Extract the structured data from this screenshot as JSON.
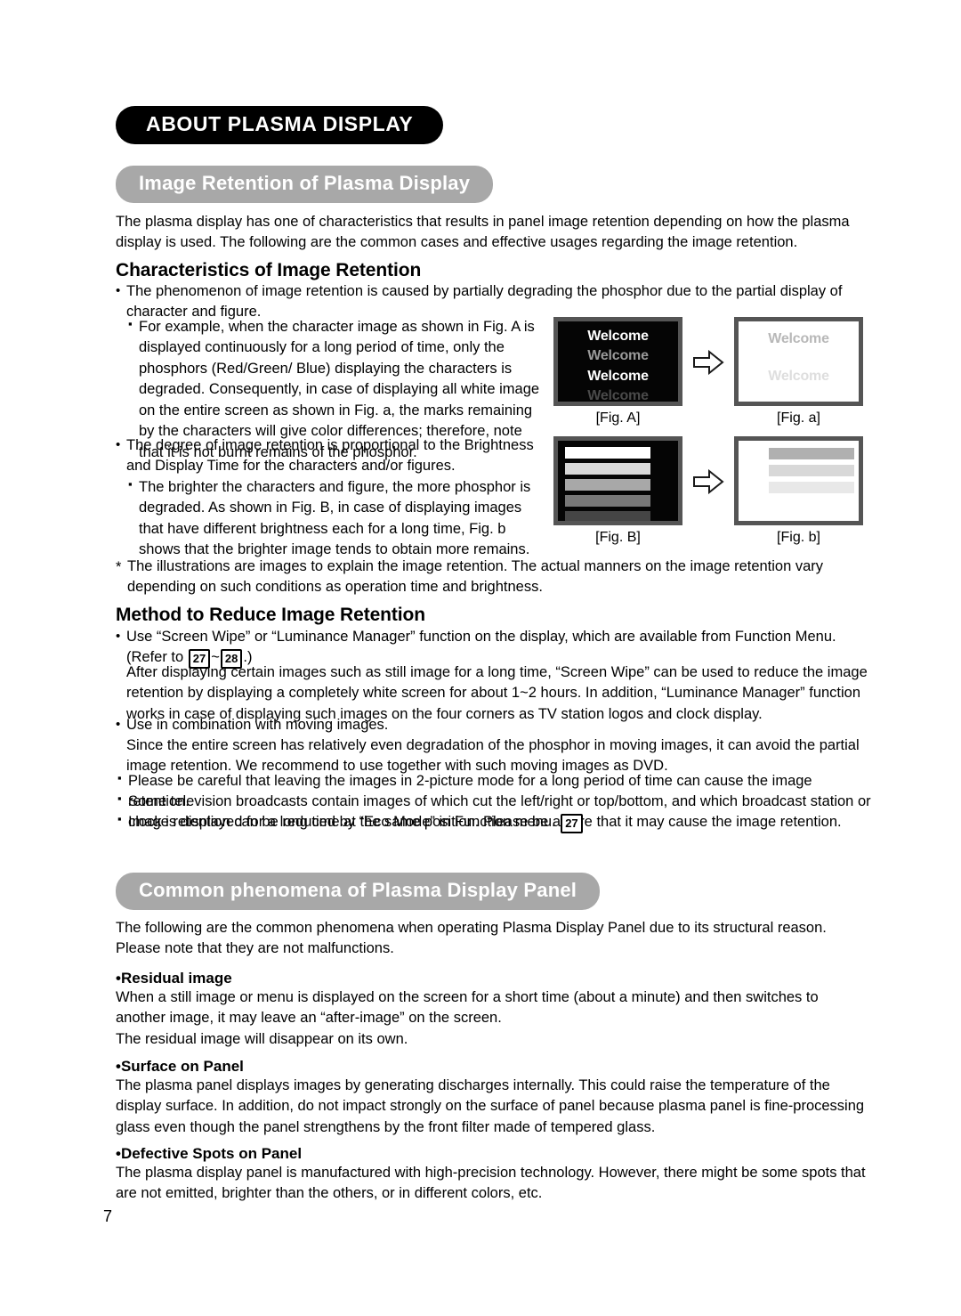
{
  "document": {
    "chapter_title": "ABOUT PLASMA DISPLAY",
    "page_number": "7"
  },
  "section_image_retention": {
    "banner": "Image Retention of Plasma Display",
    "intro": "The plasma display has one of characteristics that results in panel image retention depending on how the plasma display is used. The following are the common cases and effective usages regarding the image retention.",
    "heading_characteristics": "Characteristics of Image Retention",
    "bullet1": "The phenomenon of image retention is caused by partially degrading the phosphor due to the partial display of character and figure.",
    "sub_bullet1": "For example, when the character image as shown in Fig. A is displayed continuously for a long period of time, only the phosphors (Red/Green/ Blue) displaying the characters is degraded. Consequently, in case of displaying all white image on the entire screen as shown in Fig. a, the marks remaining by the characters will give color differences; therefore, note that it is not burnt remains of the phosphor.",
    "bullet2": "The degree of image retention is proportional to the Brightness and Display Time for the characters and/or figures.",
    "sub_bullet2": "The brighter the characters and figure, the more phosphor is degraded. As shown in Fig. B, in case of displaying images that have different brightness each for a long time, Fig. b shows that the brighter image tends to obtain more remains.",
    "note_star": "The illustrations are images to explain the image retention. The actual manners on the image retention vary depending on such conditions as operation time and brightness.",
    "heading_method": "Method to Reduce Image Retention",
    "method_bullet1_part1": "Use “Screen Wipe” or “Luminance Manager” function on the display, which are available from Function Menu. (Refer to ",
    "method_bullet1_ref1": "27",
    "method_bullet1_tilde": "~",
    "method_bullet1_ref2": "28",
    "method_bullet1_part2": ".)",
    "method_para1": "After displaying certain images such as still image for a long time, “Screen Wipe” can be used to reduce the image retention by displaying a completely white screen for about 1~2 hours. In addition, “Luminance Manager” function works in case of displaying such images on the four corners as TV station logos and clock display.",
    "method_bullet2": "Use in combination with moving images.",
    "method_para2": "Since the entire screen has relatively even degradation of the phosphor in moving images, it can avoid the partial image retention. We recommend to use together with such moving images as DVD.",
    "method_sub1": "Please be careful that leaving the images in 2-picture mode for a long period of time can cause the image retention.",
    "method_sub2": "Some television broadcasts contain images of which cut the left/right or top/bottom, and which broadcast station or clock is displayed for a long time at the same position. Please be aware that it may cause the image retention.",
    "method_sub3_text": "Image retention can be reduced by “Eco Mode” in Function menu. ",
    "method_sub3_ref": "27"
  },
  "figures": {
    "fig_a_source": {
      "label": "[Fig. A]",
      "lines": [
        {
          "text": "Welcome",
          "color": "#ffffff"
        },
        {
          "text": "Welcome",
          "color": "#9a9a9a"
        },
        {
          "text": "Welcome",
          "color": "#ffffff"
        },
        {
          "text": "Welcome",
          "color": "#4a4a4a"
        }
      ]
    },
    "fig_a_result": {
      "label": "[Fig. a]",
      "lines": [
        {
          "text": "Welcome",
          "color": "#b8b8b8"
        },
        {
          "text": "Welcome",
          "color": "#dedede"
        }
      ]
    },
    "fig_b_source": {
      "label": "[Fig. B]",
      "bars": [
        "#ffffff",
        "#d8d8d8",
        "#a8a8a8",
        "#787878",
        "#454545"
      ]
    },
    "fig_b_result": {
      "label": "[Fig. b]",
      "bars": [
        "#b0b0b0",
        "#d8d8d8",
        "#e8e8e8"
      ]
    },
    "arrow_icon": "right-arrow-outline"
  },
  "section_common_phenomena": {
    "banner": "Common phenomena of Plasma Display Panel",
    "intro": "The following are the common phenomena when operating Plasma Display Panel due to its structural reason. Please note that they are not malfunctions.",
    "items": [
      {
        "title": "Residual image",
        "body_line1": "When a still image or menu is displayed on the screen for a short time (about a minute) and then switches to another image, it may leave an “after-image” on the screen.",
        "body_line2": "The residual image will disappear on its own."
      },
      {
        "title": "Surface on Panel",
        "body_line1": "The plasma panel displays images by generating discharges internally. This could raise the temperature of the display surface. In addition, do not impact strongly on the surface of panel because plasma panel is fine-processing glass even though the panel strengthens by the front filter made of tempered glass.",
        "body_line2": ""
      },
      {
        "title": "Defective Spots on Panel",
        "body_line1": "The plasma display panel is manufactured with high-precision technology.  However, there might be some spots that are not emitted, brighter than the others, or in different colors, etc.",
        "body_line2": ""
      }
    ]
  }
}
